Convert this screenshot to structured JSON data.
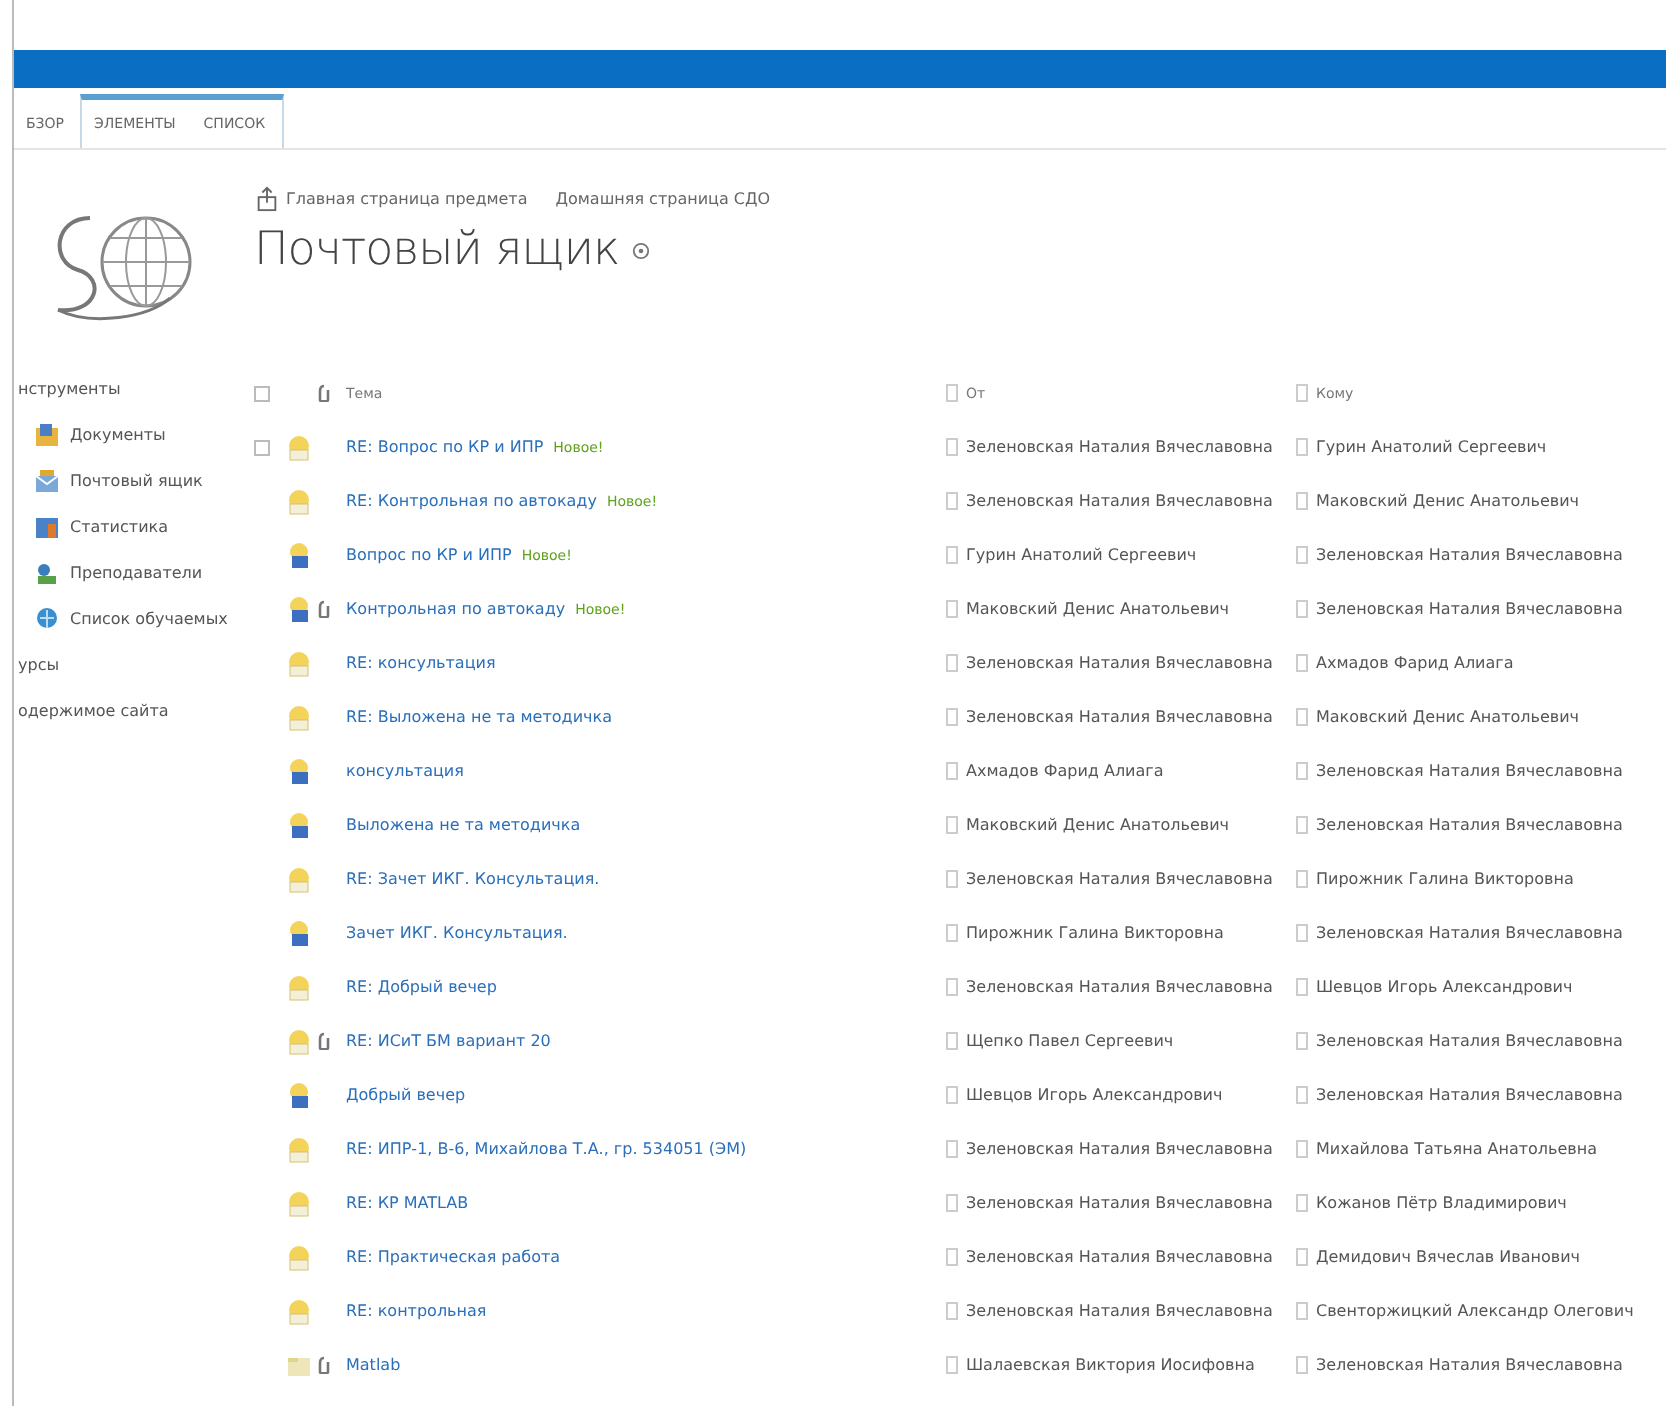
{
  "ribbon": {
    "tabs": [
      {
        "label": "БЗОР",
        "selected": false,
        "contextual": false
      },
      {
        "label": "ЭЛЕМЕНТЫ",
        "selected": false,
        "contextual": true
      },
      {
        "label": "СПИСОК",
        "selected": false,
        "contextual": true
      }
    ]
  },
  "header": {
    "breadcrumbs": [
      {
        "label": "Главная страница предмета",
        "kind": "up"
      },
      {
        "label": "Домашняя страница СДО",
        "kind": "plain"
      }
    ],
    "title": "Почтовый ящик"
  },
  "sidebar": {
    "items": [
      {
        "label": "нструменты",
        "kind": "heading"
      },
      {
        "label": "Документы",
        "kind": "documents"
      },
      {
        "label": "Почтовый ящик",
        "kind": "mailbox"
      },
      {
        "label": "Статистика",
        "kind": "stats"
      },
      {
        "label": "Преподаватели",
        "kind": "teachers"
      },
      {
        "label": "Список обучаемых",
        "kind": "students"
      },
      {
        "label": "урсы",
        "kind": "heading"
      },
      {
        "label": "одержимое сайта",
        "kind": "heading"
      }
    ]
  },
  "table": {
    "select_all": {
      "checked": false
    },
    "columns": [
      {
        "label": "Тема"
      },
      {
        "label": "От"
      },
      {
        "label": "Кому"
      }
    ],
    "rows": [
      {
        "kind": "reply",
        "attachment": false,
        "hovered": true,
        "checked": false,
        "subject": "RE: Вопрос по КР и ИПР",
        "badge": "Новое!",
        "from": "Зеленовская Наталия Вячеславовна",
        "to": "Гурин Анатолий Сергеевич"
      },
      {
        "kind": "reply",
        "attachment": false,
        "hovered": false,
        "checked": false,
        "subject": "RE: Контрольная по автокаду",
        "badge": "Новое!",
        "from": "Зеленовская Наталия Вячеславовна",
        "to": "Маковский Денис Анатольевич"
      },
      {
        "kind": "message",
        "attachment": false,
        "hovered": false,
        "checked": false,
        "subject": "Вопрос по КР и ИПР",
        "badge": "Новое!",
        "from": "Гурин Анатолий Сергеевич",
        "to": "Зеленовская Наталия Вячеславовна"
      },
      {
        "kind": "message",
        "attachment": true,
        "hovered": false,
        "checked": false,
        "subject": "Контрольная по автокаду",
        "badge": "Новое!",
        "from": "Маковский Денис Анатольевич",
        "to": "Зеленовская Наталия Вячеславовна"
      },
      {
        "kind": "reply",
        "attachment": false,
        "hovered": false,
        "checked": false,
        "subject": "RE: консультация",
        "from": "Зеленовская Наталия Вячеславовна",
        "to": "Ахмадов Фарид Алиага"
      },
      {
        "kind": "reply",
        "attachment": false,
        "hovered": false,
        "checked": false,
        "subject": "RE: Выложена не та методичка",
        "from": "Зеленовская Наталия Вячеславовна",
        "to": "Маковский Денис Анатольевич"
      },
      {
        "kind": "message",
        "attachment": false,
        "hovered": false,
        "checked": false,
        "subject": "консультация",
        "from": "Ахмадов Фарид Алиага",
        "to": "Зеленовская Наталия Вячеславовна"
      },
      {
        "kind": "message",
        "attachment": false,
        "hovered": false,
        "checked": false,
        "subject": "Выложена не та методичка",
        "from": "Маковский Денис Анатольевич",
        "to": "Зеленовская Наталия Вячеславовна"
      },
      {
        "kind": "reply",
        "attachment": false,
        "hovered": false,
        "checked": false,
        "subject": "RE: Зачет ИКГ. Консультация.",
        "from": "Зеленовская Наталия Вячеславовна",
        "to": "Пирожник Галина Викторовна"
      },
      {
        "kind": "message",
        "attachment": false,
        "hovered": false,
        "checked": false,
        "subject": "Зачет ИКГ. Консультация.",
        "from": "Пирожник Галина Викторовна",
        "to": "Зеленовская Наталия Вячеславовна"
      },
      {
        "kind": "reply",
        "attachment": false,
        "hovered": false,
        "checked": false,
        "subject": "RE: Добрый вечер",
        "from": "Зеленовская Наталия Вячеславовна",
        "to": "Шевцов Игорь Александрович"
      },
      {
        "kind": "reply",
        "attachment": true,
        "hovered": false,
        "checked": false,
        "subject": "RE: ИСиТ БМ вариант 20",
        "from": "Щепко Павел Сергеевич",
        "to": "Зеленовская Наталия Вячеславовна"
      },
      {
        "kind": "message",
        "attachment": false,
        "hovered": false,
        "checked": false,
        "subject": "Добрый вечер",
        "from": "Шевцов Игорь Александрович",
        "to": "Зеленовская Наталия Вячеславовна"
      },
      {
        "kind": "reply",
        "attachment": false,
        "hovered": false,
        "checked": false,
        "subject": "RE: ИПР-1, В-6, Михайлова Т.А., гр. 534051 (ЭМ)",
        "from": "Зеленовская Наталия Вячеславовна",
        "to": "Михайлова Татьяна Анатольевна"
      },
      {
        "kind": "reply",
        "attachment": false,
        "hovered": false,
        "checked": false,
        "subject": "RE: КР MATLAB",
        "from": "Зеленовская Наталия Вячеславовна",
        "to": "Кожанов Пётр Владимирович"
      },
      {
        "kind": "reply",
        "attachment": false,
        "hovered": false,
        "checked": false,
        "subject": "RE: Практическая работа",
        "from": "Зеленовская Наталия Вячеславовна",
        "to": "Демидович Вячеслав Иванович"
      },
      {
        "kind": "reply",
        "attachment": false,
        "hovered": false,
        "checked": false,
        "subject": "RE: контрольная",
        "from": "Зеленовская Наталия Вячеславовна",
        "to": "Свенторжицкий Александр Олегович"
      },
      {
        "kind": "draft",
        "attachment": true,
        "hovered": false,
        "checked": false,
        "subject": "Matlab",
        "from": "Шалаевская Виктория Иосифовна",
        "to": "Зеленовская Наталия Вячеславовна"
      }
    ]
  }
}
